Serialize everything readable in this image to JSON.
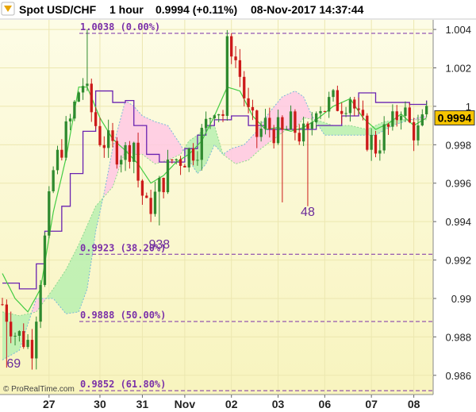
{
  "header": {
    "title": "Spot USD/CHF",
    "interval": "1 hour",
    "last_price": "0.9994 (+0.11%)",
    "timestamp": "08-Nov-2017 14:37:44"
  },
  "credit": "© ProRealTime.com",
  "price_badge": "0.9994",
  "colors": {
    "background_top": "#fdfce6",
    "background_bottom": "#f8f4be",
    "candle_up": "#2f8a2f",
    "candle_down": "#cc1a1a",
    "kijun": "#6a22b0",
    "tenkan": "#44cc44",
    "cloud_bull": "#b8f0b0",
    "cloud_bear": "#ffc8e4",
    "fib_line": "#7a2fa8",
    "badge": "#f5c400"
  },
  "chart_data": {
    "type": "candlestick",
    "y_axis": {
      "ylim": [
        0.985,
        1.0045
      ],
      "ticks": [
        "1.004",
        "1.002",
        "1",
        "0.998",
        "0.996",
        "0.994",
        "0.992",
        "0.99",
        "0.988",
        "0.986"
      ],
      "tick_values": [
        1.004,
        1.002,
        1.0,
        0.998,
        0.996,
        0.994,
        0.992,
        0.99,
        0.988,
        0.986
      ]
    },
    "x_axis": {
      "range": [
        0,
        101
      ],
      "labels": [
        {
          "label": "27",
          "bar": 11
        },
        {
          "label": "30",
          "bar": 23
        },
        {
          "label": "31",
          "bar": 33
        },
        {
          "label": "Nov",
          "bar": 43
        },
        {
          "label": "02",
          "bar": 54
        },
        {
          "label": "03",
          "bar": 65
        },
        {
          "label": "06",
          "bar": 76
        },
        {
          "label": "07",
          "bar": 87
        },
        {
          "label": "08",
          "bar": 97
        }
      ]
    },
    "fib_levels": [
      {
        "label": "1.0038 (0.00%)",
        "value": 1.0038
      },
      {
        "label": "0.9923 (38.20%)",
        "value": 0.9923
      },
      {
        "label": "0.9888 (50.00%)",
        "value": 0.9888
      },
      {
        "label": "0.9852 (61.80%)",
        "value": 0.9852
      }
    ],
    "annotations": [
      {
        "text": "69",
        "bar": 1,
        "value": 0.9864
      },
      {
        "text": "938",
        "bar": 37,
        "value": 0.9926
      },
      {
        "text": "48",
        "bar": 72,
        "value": 0.9943
      }
    ],
    "close_anchors": [
      [
        0,
        0.9897
      ],
      [
        3,
        0.9882
      ],
      [
        7,
        0.9876
      ],
      [
        9,
        0.9912
      ],
      [
        12,
        0.9966
      ],
      [
        14,
        0.998
      ],
      [
        16,
        0.9992
      ],
      [
        18,
        1.0008
      ],
      [
        19,
        1.0012
      ],
      [
        21,
        0.9997
      ],
      [
        23,
        0.9984
      ],
      [
        26,
        0.9978
      ],
      [
        29,
        0.9976
      ],
      [
        31,
        0.9982
      ],
      [
        32,
        0.9962
      ],
      [
        34,
        0.9946
      ],
      [
        36,
        0.9953
      ],
      [
        38,
        0.9962
      ],
      [
        40,
        0.9972
      ],
      [
        43,
        0.9974
      ],
      [
        46,
        0.998
      ],
      [
        48,
        0.999
      ],
      [
        50,
        1.0002
      ],
      [
        52,
        0.9996
      ],
      [
        53,
        1.003
      ],
      [
        54,
        1.0032
      ],
      [
        56,
        1.0016
      ],
      [
        58,
        0.9995
      ],
      [
        60,
        0.9985
      ],
      [
        62,
        0.999
      ],
      [
        64,
        0.9988
      ],
      [
        66,
        0.9985
      ],
      [
        68,
        0.999
      ],
      [
        70,
        0.9986
      ],
      [
        72,
        0.9983
      ],
      [
        74,
        1.0003
      ],
      [
        76,
        1.0
      ],
      [
        78,
        1.0002
      ],
      [
        80,
        1.0002
      ],
      [
        82,
        1.0006
      ],
      [
        84,
        0.9992
      ],
      [
        86,
        0.9984
      ],
      [
        88,
        0.9979
      ],
      [
        90,
        0.9986
      ],
      [
        92,
        0.999
      ],
      [
        94,
        1.0001
      ],
      [
        96,
        0.999
      ],
      [
        98,
        0.9986
      ],
      [
        100,
        0.9994
      ]
    ],
    "kijun_steps": [
      [
        0,
        0.9908
      ],
      [
        4,
        0.9905
      ],
      [
        8,
        0.9918
      ],
      [
        10,
        0.9935
      ],
      [
        14,
        0.9948
      ],
      [
        16,
        0.9965
      ],
      [
        19,
        0.9987
      ],
      [
        22,
        1.0008
      ],
      [
        26,
        1.0002
      ],
      [
        29,
        1.0003
      ],
      [
        31,
        0.999
      ],
      [
        34,
        0.9975
      ],
      [
        37,
        0.9971
      ],
      [
        43,
        0.9978
      ],
      [
        46,
        0.9985
      ],
      [
        48,
        0.999
      ],
      [
        50,
        0.9993
      ],
      [
        54,
        0.9995
      ],
      [
        58,
        0.999
      ],
      [
        62,
        0.9988
      ],
      [
        70,
        0.9988
      ],
      [
        74,
        0.999
      ],
      [
        80,
        0.9995
      ],
      [
        84,
        1.0007
      ],
      [
        88,
        1.0002
      ],
      [
        96,
        1.0001
      ],
      [
        100,
        1.0003
      ]
    ],
    "tenkan_anchors": [
      [
        0,
        0.9913
      ],
      [
        3,
        0.99
      ],
      [
        6,
        0.9893
      ],
      [
        9,
        0.9905
      ],
      [
        12,
        0.9945
      ],
      [
        15,
        0.9973
      ],
      [
        18,
        1.001
      ],
      [
        20,
        1.001
      ],
      [
        23,
        0.9994
      ],
      [
        26,
        0.9983
      ],
      [
        29,
        0.9977
      ],
      [
        32,
        0.997
      ],
      [
        35,
        0.996
      ],
      [
        38,
        0.9964
      ],
      [
        41,
        0.9971
      ],
      [
        44,
        0.9975
      ],
      [
        47,
        0.9982
      ],
      [
        50,
        0.9995
      ],
      [
        53,
        1.001
      ],
      [
        56,
        1.0008
      ],
      [
        59,
        0.9995
      ],
      [
        62,
        0.9988
      ],
      [
        65,
        0.9989
      ],
      [
        68,
        0.9987
      ],
      [
        71,
        0.9989
      ],
      [
        74,
        0.9993
      ],
      [
        78,
        1.0
      ],
      [
        82,
        1.0004
      ],
      [
        85,
        0.9994
      ],
      [
        88,
        0.9988
      ],
      [
        91,
        0.9991
      ],
      [
        94,
        0.9996
      ],
      [
        97,
        0.999
      ],
      [
        100,
        0.9994
      ]
    ],
    "span_a": [
      [
        0,
        0.9893
      ],
      [
        4,
        0.9891
      ],
      [
        8,
        0.9893
      ],
      [
        12,
        0.9905
      ],
      [
        15,
        0.9915
      ],
      [
        18,
        0.9928
      ],
      [
        20,
        0.9938
      ],
      [
        22,
        0.9948
      ],
      [
        26,
        0.9958
      ],
      [
        29,
        0.9977
      ],
      [
        31,
        0.9975
      ],
      [
        33,
        0.9975
      ],
      [
        36,
        0.997
      ],
      [
        39,
        0.9972
      ],
      [
        42,
        0.9975
      ],
      [
        44,
        0.9982
      ],
      [
        46,
        0.9985
      ],
      [
        48,
        0.9989
      ],
      [
        50,
        0.999
      ],
      [
        52,
        0.9975
      ],
      [
        55,
        0.997
      ],
      [
        58,
        0.9972
      ],
      [
        61,
        0.9978
      ],
      [
        64,
        0.9983
      ],
      [
        67,
        0.9988
      ],
      [
        69,
        0.9988
      ],
      [
        71,
        0.9994
      ],
      [
        74,
        0.9993
      ],
      [
        78,
        0.999
      ],
      [
        82,
        0.999
      ],
      [
        86,
        0.9988
      ],
      [
        90,
        0.9992
      ],
      [
        94,
        0.9993
      ],
      [
        97,
        0.9993
      ],
      [
        100,
        0.9993
      ]
    ],
    "span_b": [
      [
        0,
        0.9868
      ],
      [
        4,
        0.9873
      ],
      [
        8,
        0.99
      ],
      [
        12,
        0.99
      ],
      [
        15,
        0.9892
      ],
      [
        18,
        0.9893
      ],
      [
        20,
        0.9905
      ],
      [
        22,
        0.9935
      ],
      [
        24,
        0.9955
      ],
      [
        26,
        0.9978
      ],
      [
        29,
        1.0003
      ],
      [
        31,
        1.0
      ],
      [
        33,
        0.9995
      ],
      [
        36,
        0.9992
      ],
      [
        39,
        0.999
      ],
      [
        42,
        0.998
      ],
      [
        44,
        0.9972
      ],
      [
        46,
        0.9965
      ],
      [
        48,
        0.997
      ],
      [
        50,
        0.998
      ],
      [
        52,
        0.9975
      ],
      [
        54,
        0.9978
      ],
      [
        57,
        0.998
      ],
      [
        60,
        0.9987
      ],
      [
        63,
        0.9997
      ],
      [
        66,
        1.0005
      ],
      [
        69,
        1.0008
      ],
      [
        71,
        1.0005
      ],
      [
        73,
        0.9995
      ],
      [
        76,
        0.9985
      ],
      [
        80,
        0.9985
      ],
      [
        84,
        0.9985
      ],
      [
        88,
        0.9985
      ],
      [
        92,
        0.999
      ],
      [
        96,
        0.9993
      ],
      [
        100,
        0.9995
      ]
    ]
  }
}
